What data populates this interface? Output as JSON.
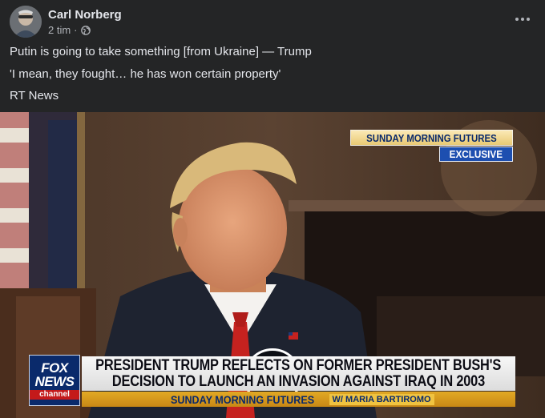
{
  "post": {
    "author": "Carl Norberg",
    "time": "2 tim",
    "separator": "·",
    "audience_icon": "globe-icon",
    "menu_icon": "more-options-icon",
    "lines": [
      "Putin is going to take something [from Ukraine] — Trump",
      "'I mean, they fought… he has won certain property'",
      "RT News"
    ]
  },
  "video": {
    "play_icon": "play-icon",
    "bug": {
      "show": "SUNDAY MORNING FUTURES",
      "tag": "EXCLUSIVE"
    },
    "lower_third": {
      "logo_line1": "FOX",
      "logo_line2": "NEWS",
      "logo_line3": "channel",
      "headline_line1": "PRESIDENT TRUMP REFLECTS ON FORMER PRESIDENT BUSH'S",
      "headline_line2": "DECISION TO LAUNCH AN INVASION AGAINST IRAQ IN 2003",
      "show_name": "SUNDAY MORNING FUTURES",
      "host": "W/ MARIA BARTIROMO"
    }
  },
  "colors": {
    "background": "#242526",
    "primary_text": "#e4e6eb",
    "secondary_text": "#b0b3b8",
    "fox_blue": "#0a2a6b",
    "fox_gold": "#e2a925"
  }
}
